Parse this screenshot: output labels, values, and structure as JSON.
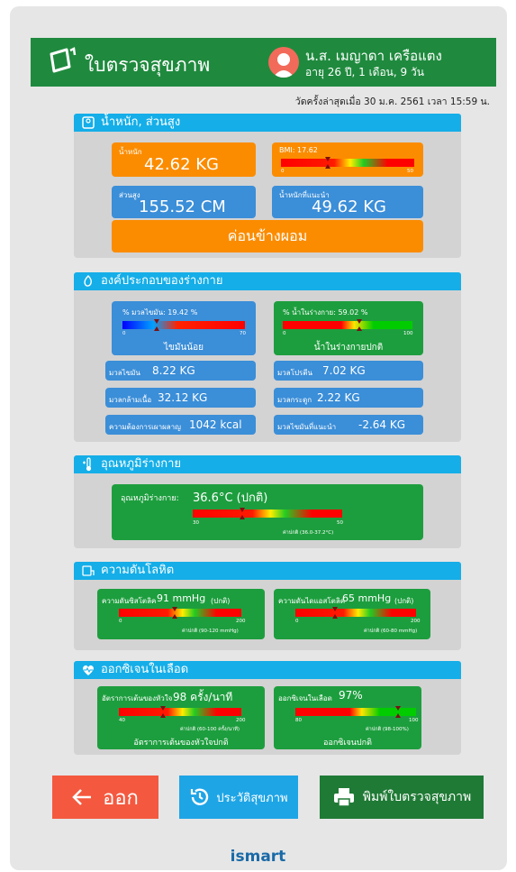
{
  "header": {
    "title": "ใบตรวจสุขภาพ",
    "name": "น.ส. เมญาดา เครือแตง",
    "age": "อายุ 26 ปี, 1 เดือน, 9 วัน"
  },
  "last_date": "วัดครั้งล่าสุดเมื่อ 30 ม.ค. 2561 เวลา 15:59 น.",
  "weight_section": {
    "title": "น้ำหนัก, ส่วนสูง",
    "weight_label": "น้ำหนัก",
    "weight_value": "42.62 KG",
    "bmi_label": "BMI: 17.62",
    "bmi_min": "0",
    "bmi_max": "50",
    "bmi_fraction": 0.35,
    "height_label": "ส่วนสูง",
    "height_value": "155.52 CM",
    "ideal_label": "น้ำหนักที่แนะนำ",
    "ideal_value": "49.62 KG",
    "status": "ค่อนข้างผอม"
  },
  "body_section": {
    "title": "องค์ประกอบของร่างกาย",
    "fat_label": "% มวลไขมัน: 19.42 %",
    "fat_min": "0",
    "fat_max": "70",
    "fat_fraction": 0.28,
    "fat_status": "ไขมันน้อย",
    "water_label": "% น้ำในร่างกาย: 59.02 %",
    "water_min": "0",
    "water_max": "100",
    "water_fraction": 0.59,
    "water_status": "น้ำในร่างกายปกติ",
    "fat_mass_label": "มวลไขมัน",
    "fat_mass_value": "8.22 KG",
    "protein_label": "มวลโปรตีน",
    "protein_value": "7.02 KG",
    "muscle_label": "มวลกล้ามเนื้อ",
    "muscle_value": "32.12 KG",
    "bone_label": "มวลกระดูก",
    "bone_value": "2.22 KG",
    "energy_label": "ความต้องการเผาผลาญ",
    "energy_value": "1042 kcal",
    "fat_target_label": "มวลไขมันที่แนะนำ",
    "fat_target_value": "-2.64 KG"
  },
  "temp_section": {
    "title": "อุณหภูมิร่างกาย",
    "label": "อุณหภูมิร่างกาย:",
    "value": "36.6°C (ปกติ)",
    "min": "30",
    "max": "50",
    "fraction": 0.33,
    "normal": "ค่าปกติ (36.0-37.2°C)"
  },
  "bp_section": {
    "title": "ความดันโลหิต",
    "sys_label": "ความดันซิสโตลิค",
    "sys_value": "91 mmHg",
    "sys_status": "(ปกติ)",
    "sys_min": "0",
    "sys_max": "200",
    "sys_fraction": 0.455,
    "sys_normal": "ค่าปกติ (90-120 mmHg)",
    "dia_label": "ความดันไดแอสโตลิค",
    "dia_value": "65 mmHg",
    "dia_status": "(ปกติ)",
    "dia_min": "0",
    "dia_max": "200",
    "dia_fraction": 0.325,
    "dia_normal": "ค่าปกติ (60-80 mmHg)"
  },
  "oxygen_section": {
    "title": "ออกซิเจนในเลือด",
    "hr_label": "อัตราการเต้นของหัวใจ",
    "hr_value": "98 ครั้ง/นาที",
    "hr_min": "40",
    "hr_max": "200",
    "hr_fraction": 0.3625,
    "hr_normal": "ค่าปกติ (60-100 ครั้ง/นาที)",
    "hr_status": "อัตราการเต้นของหัวใจปกติ",
    "spo2_label": "ออกซิเจนในเลือด",
    "spo2_value": "97%",
    "spo2_min": "80",
    "spo2_max": "100",
    "spo2_fraction": 0.85,
    "spo2_normal": "ค่าปกติ (98-100%)",
    "spo2_status": "ออกซิเจนปกติ"
  },
  "buttons": {
    "exit": "ออก",
    "history": "ประวัติสุขภาพ",
    "print": "พิมพ์ใบตรวจสุขภาพ"
  },
  "footer": "ismart",
  "colors": {
    "header": "#1f8a3e",
    "section_head": "#15aee8",
    "orange": "#fb8c00",
    "blue": "#3b8ed8",
    "green": "#1d9e3e",
    "exit_button": "#f4593f",
    "history_button": "#1ea5e6",
    "print_button": "#1f7a35"
  }
}
